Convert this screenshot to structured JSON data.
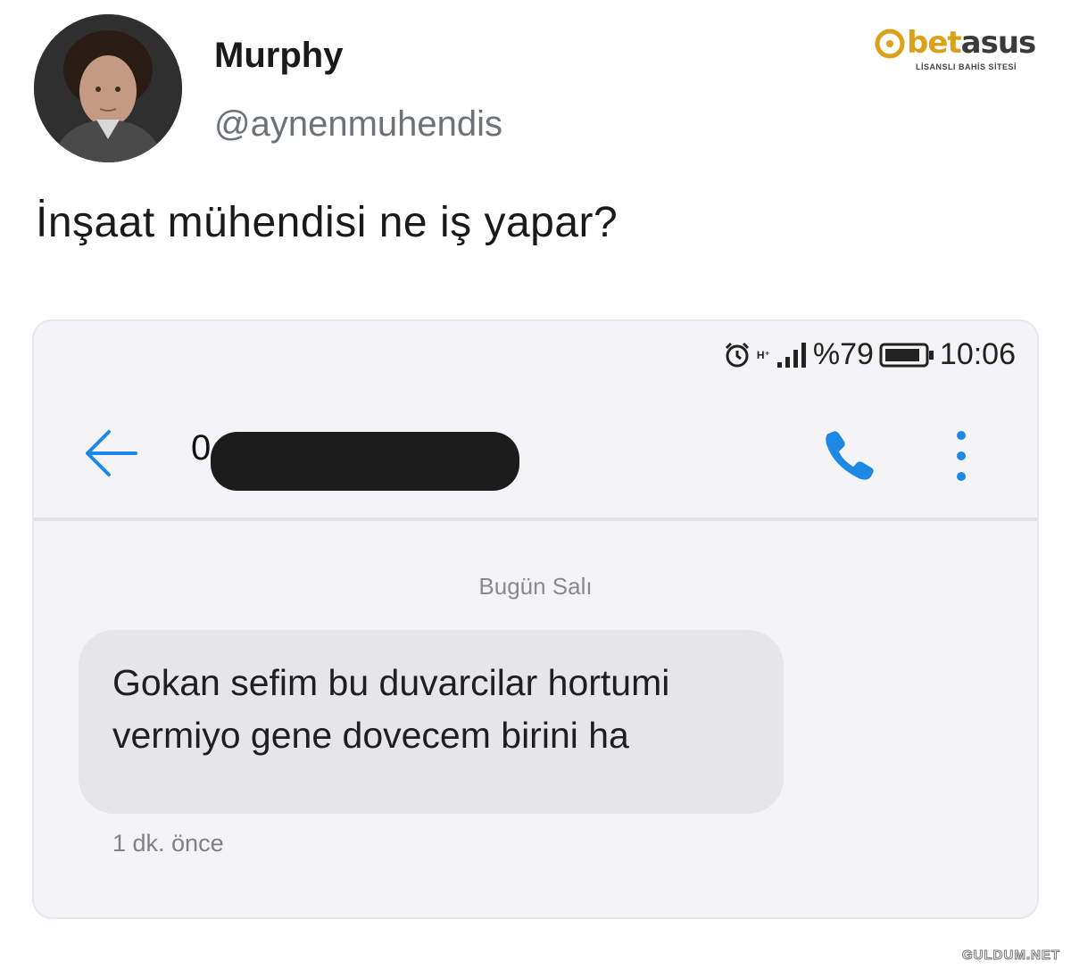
{
  "profile": {
    "display_name": "Murphy",
    "handle": "@aynenmuhendis",
    "avatar_icon": "user-avatar-photo"
  },
  "tweet": {
    "text": "İnşaat mühendisi ne iş yapar?"
  },
  "logo": {
    "brand_prefix": "bet",
    "brand_suffix": "asus",
    "tagline": "LİSANSLI BAHİS SİTESİ",
    "color": "#d9a21a"
  },
  "phone": {
    "status_bar": {
      "network": "H⁺",
      "battery_text": "%79",
      "time": "10:06",
      "icons": [
        "alarm-icon",
        "signal-icon",
        "battery-icon"
      ]
    },
    "header": {
      "contact_visible_prefix": "0",
      "back_icon": "arrow-left-icon",
      "call_icon": "phone-icon",
      "menu_icon": "more-vertical-icon",
      "accent_color": "#1e88e5"
    },
    "conversation": {
      "date_label": "Bugün Salı",
      "message": {
        "text": "Gokan sefim bu duvarcilar hortumi vermiyo gene dovecem birini ha",
        "time": "1 dk. önce"
      }
    }
  },
  "watermark": "GULDUM.NET"
}
